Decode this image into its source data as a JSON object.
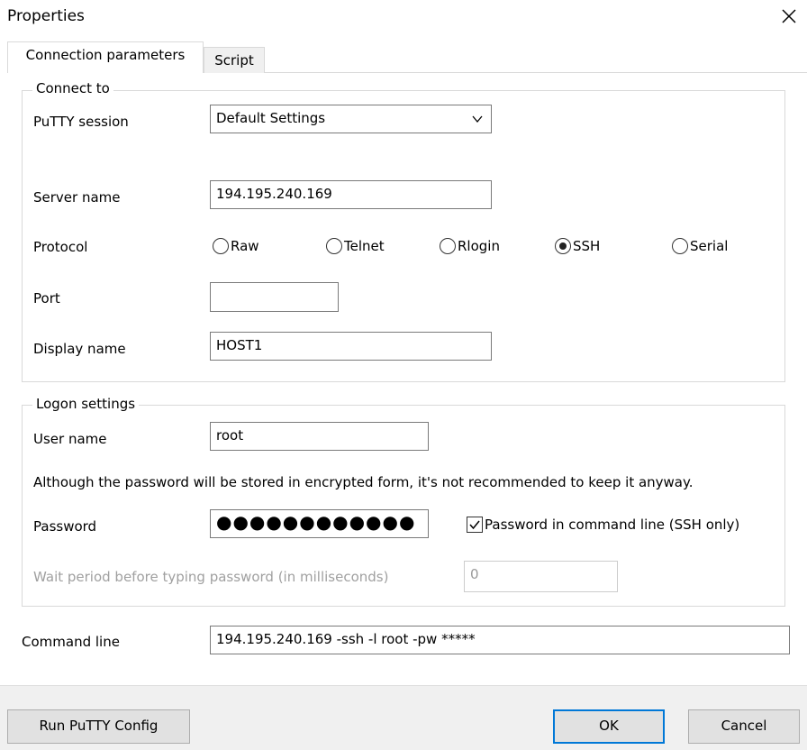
{
  "window": {
    "title": "Properties"
  },
  "tabs": [
    {
      "label": "Connection parameters"
    },
    {
      "label": "Script"
    }
  ],
  "connect_to": {
    "legend": "Connect to",
    "putty_session_label": "PuTTY session",
    "putty_session_value": "Default Settings",
    "server_name_label": "Server name",
    "server_name_value": "194.195.240.169",
    "protocol_label": "Protocol",
    "protocols": [
      "Raw",
      "Telnet",
      "Rlogin",
      "SSH",
      "Serial"
    ],
    "selected_protocol": "SSH",
    "port_label": "Port",
    "port_value": "",
    "display_name_label": "Display name",
    "display_name_value": "HOST1"
  },
  "logon": {
    "legend": "Logon settings",
    "user_name_label": "User name",
    "user_name_value": "root",
    "warning": "Although the password will be stored in encrypted form, it's not recommended to keep it anyway.",
    "password_label": "Password",
    "password_value": "●●●●●●●●●●●●",
    "pw_in_cmdline_label": "Password in command line (SSH only)",
    "pw_in_cmdline_checked": true,
    "wait_label": "Wait period before typing password (in milliseconds)",
    "wait_value": "0"
  },
  "command_line": {
    "label": "Command line",
    "value": "194.195.240.169 -ssh -l root -pw *****"
  },
  "buttons": {
    "run_putty_config": "Run PuTTY Config",
    "ok": "OK",
    "cancel": "Cancel"
  },
  "colors": {
    "focus_border": "#0078d7",
    "group_border": "#d9d9d9",
    "footer_bg": "#f0f0f0"
  }
}
